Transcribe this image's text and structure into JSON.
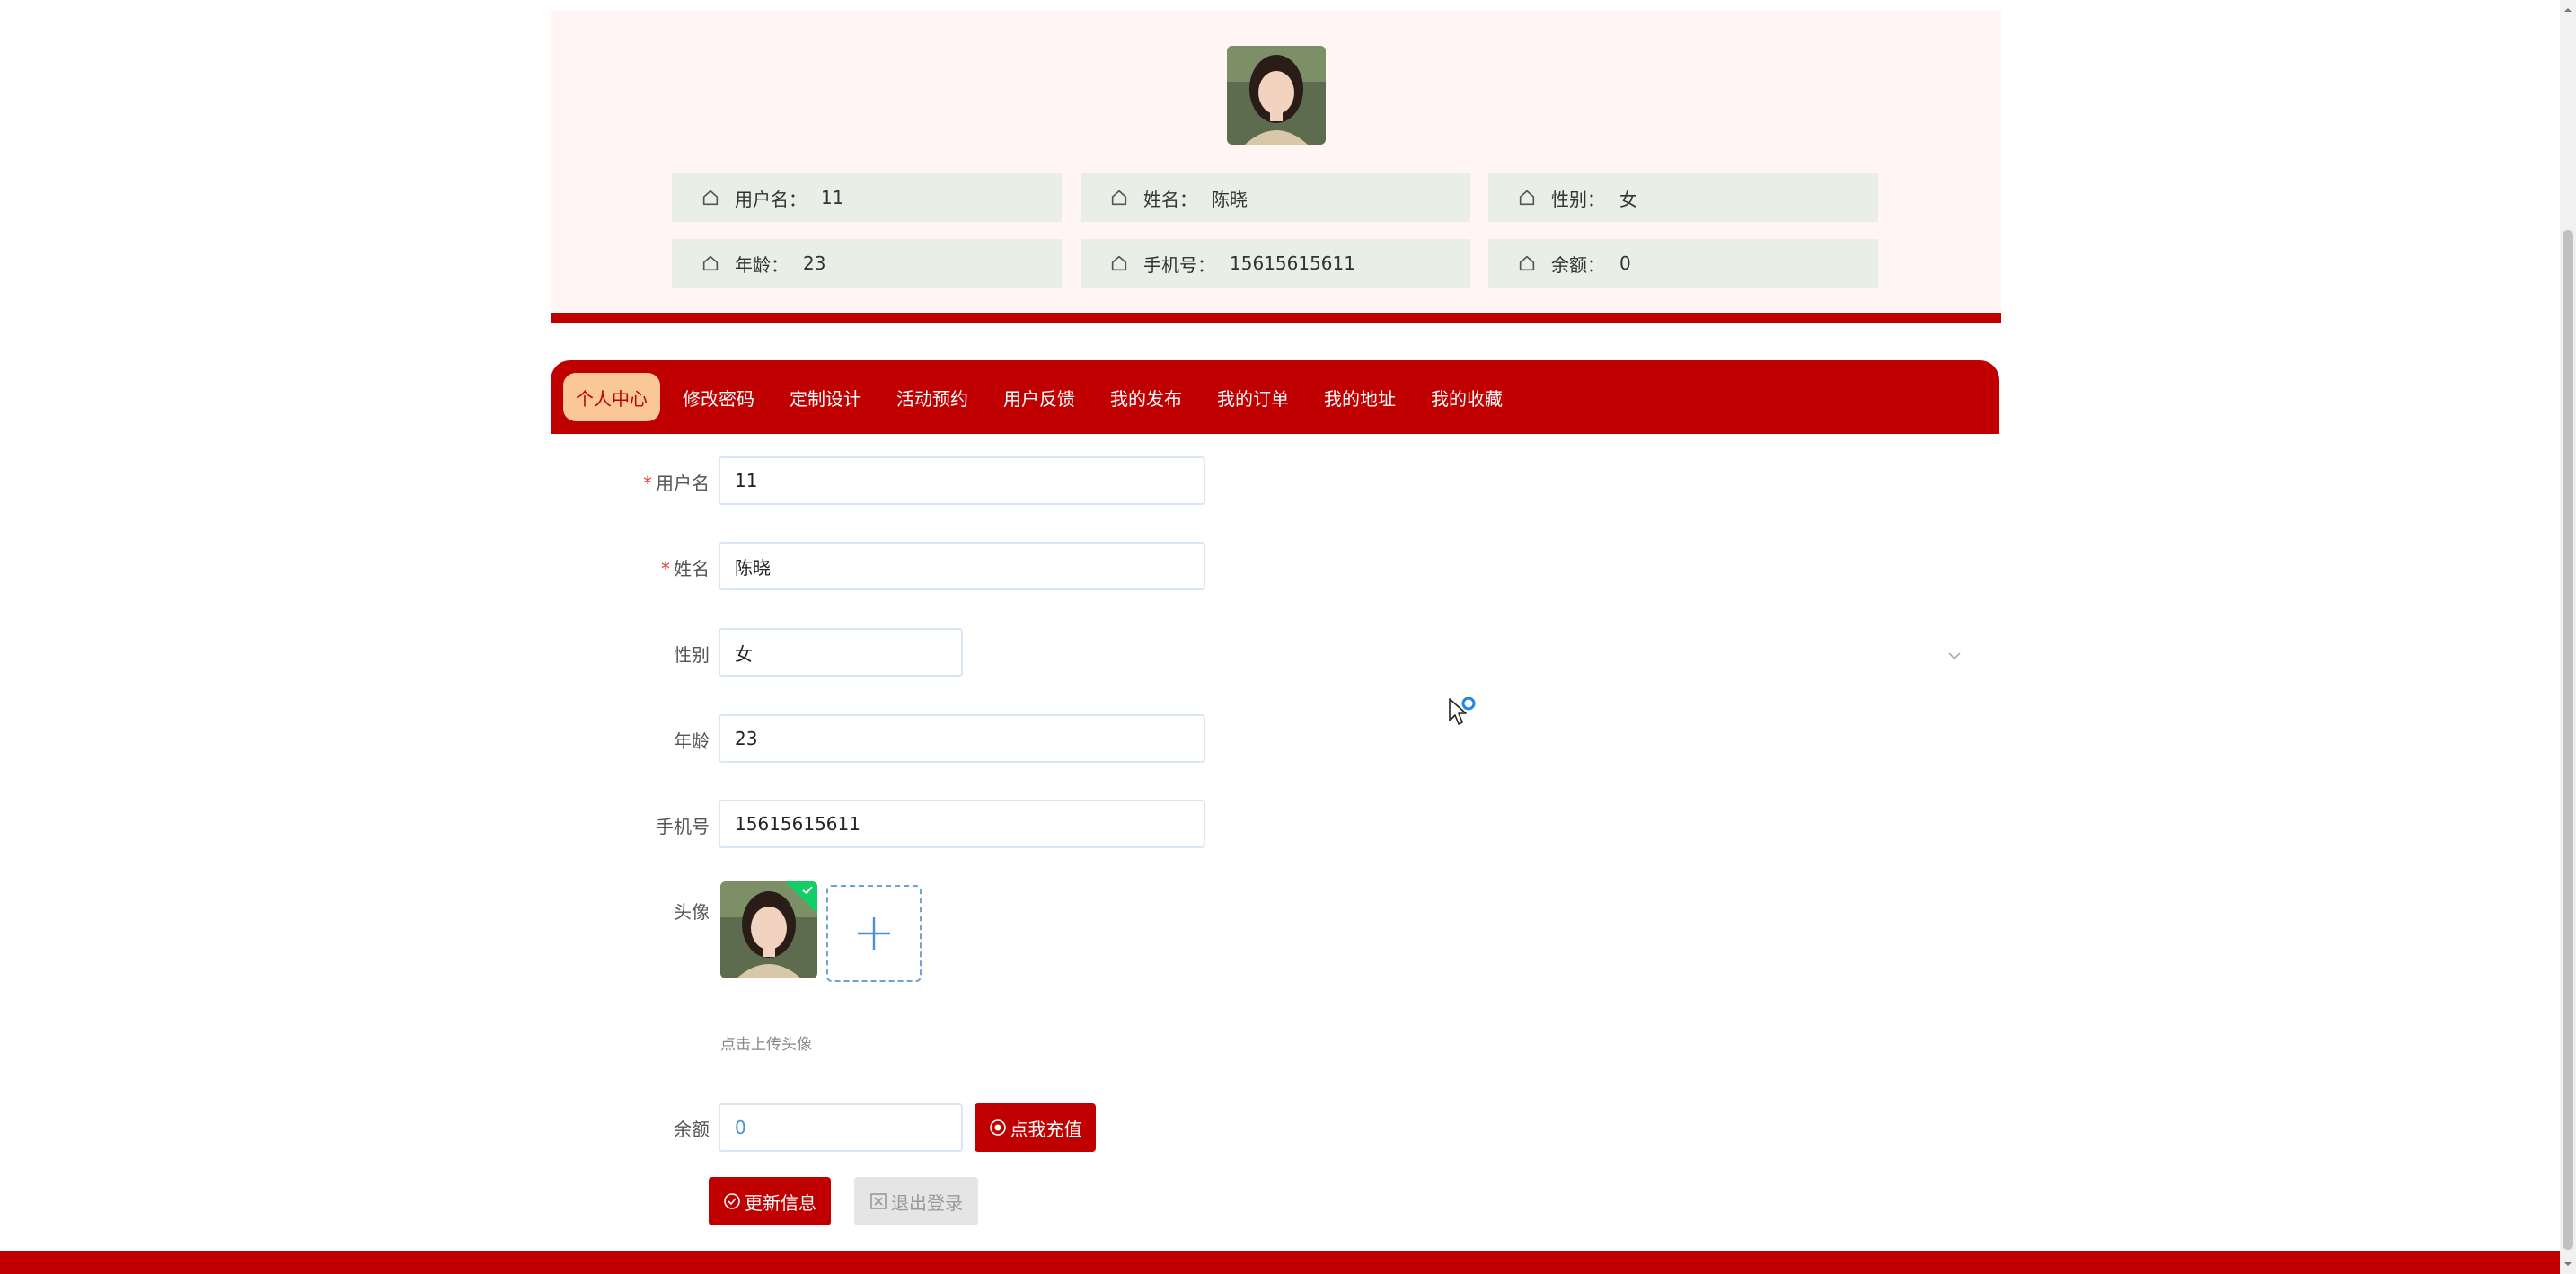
{
  "colors": {
    "accent": "#c00000",
    "card_bg": "#fff5f5",
    "info_box_bg": "#e9efe7",
    "active_tab_bg": "#f9c896",
    "upload_success": "#13ce66"
  },
  "profile": {
    "avatar": "avatar-photo",
    "info": [
      {
        "label": "用户名：",
        "value": "11"
      },
      {
        "label": "姓名：",
        "value": "陈晓"
      },
      {
        "label": "性别：",
        "value": "女"
      },
      {
        "label": "年龄：",
        "value": "23"
      },
      {
        "label": "手机号：",
        "value": "15615615611"
      },
      {
        "label": "余额：",
        "value": "0"
      }
    ]
  },
  "nav": {
    "items": [
      {
        "label": "个人中心",
        "active": true
      },
      {
        "label": "修改密码"
      },
      {
        "label": "定制设计"
      },
      {
        "label": "活动预约"
      },
      {
        "label": "用户反馈"
      },
      {
        "label": "我的发布"
      },
      {
        "label": "我的订单"
      },
      {
        "label": "我的地址"
      },
      {
        "label": "我的收藏"
      }
    ]
  },
  "form": {
    "username": {
      "label": "用户名",
      "required": true,
      "value": "11"
    },
    "name": {
      "label": "姓名",
      "required": true,
      "value": "陈晓"
    },
    "gender": {
      "label": "性别",
      "value": "女"
    },
    "age": {
      "label": "年龄",
      "value": "23"
    },
    "phone": {
      "label": "手机号",
      "value": "15615615611"
    },
    "avatar": {
      "label": "头像",
      "hint": "点击上传头像"
    },
    "balance": {
      "label": "余额",
      "value": "0",
      "recharge_label": "点我充值"
    }
  },
  "actions": {
    "update_label": "更新信息",
    "logout_label": "退出登录"
  },
  "icons": {
    "info": "home-icon",
    "upload_add": "plus-icon",
    "recharge": "circle-dot-icon",
    "update": "check-circle-icon",
    "logout": "close-square-icon",
    "select": "chevron-down-icon"
  }
}
